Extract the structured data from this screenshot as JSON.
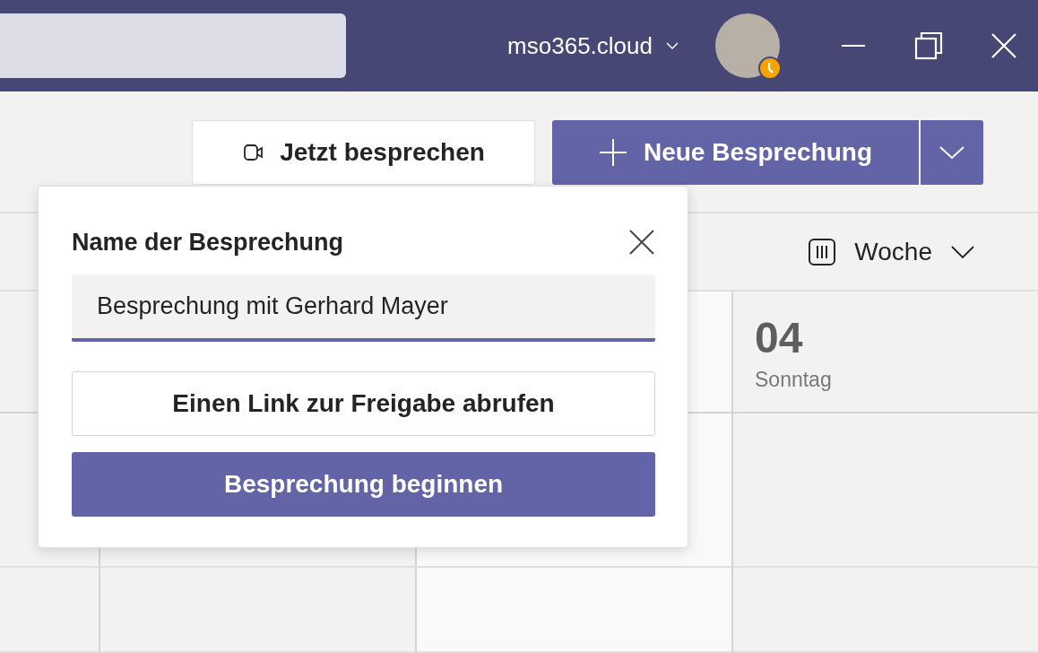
{
  "title_bar": {
    "org": "mso365.cloud"
  },
  "toolbar": {
    "meet_now": "Jetzt besprechen",
    "new_meeting": "Neue Besprechung"
  },
  "calendar": {
    "view": "Woche",
    "days": [
      {
        "number": "04",
        "weekday": "Sonntag"
      }
    ]
  },
  "popup": {
    "title": "Name der Besprechung",
    "name_field": {
      "value": "Besprechung mit Gerhard Mayer"
    },
    "buttons": [
      {
        "label": "Einen Link zur Freigabe abrufen",
        "kind": "secondary"
      },
      {
        "label": "Besprechung beginnen",
        "kind": "primary"
      }
    ]
  }
}
